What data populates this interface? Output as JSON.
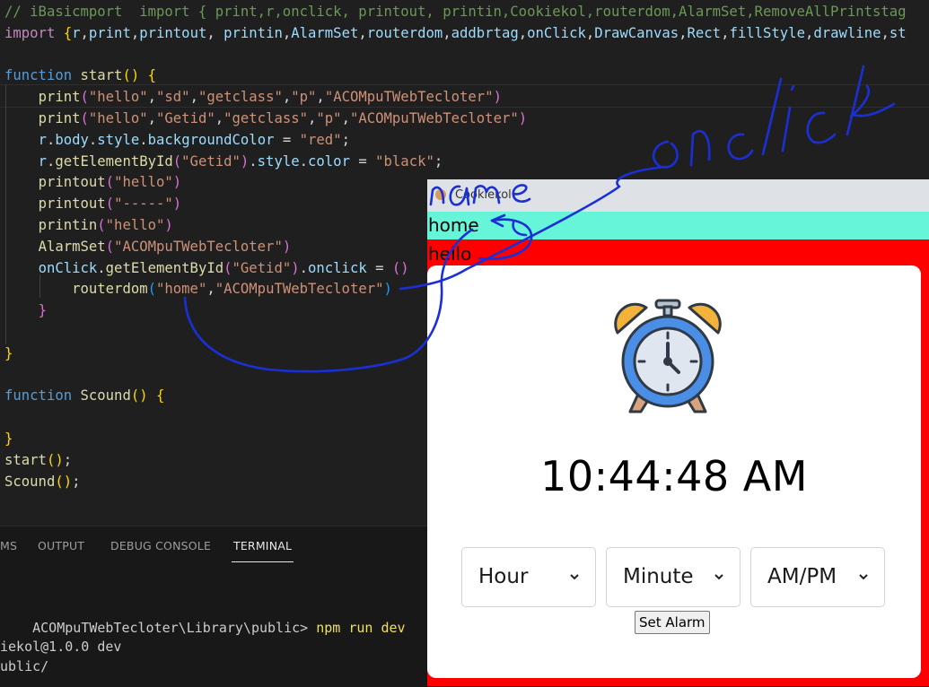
{
  "editor": {
    "lines": [
      [
        [
          "tk-cmt",
          "// iBasicmport  import { print,r,onclick, printout, printin,Cookiekol,routerdom,AlarmSet,RemoveAllPrintstag"
        ]
      ],
      [
        [
          "tk-kw2",
          "import "
        ],
        [
          "tk-b1",
          "{"
        ],
        [
          "tk-var",
          "r"
        ],
        [
          "tk-pl",
          ","
        ],
        [
          "tk-var",
          "print"
        ],
        [
          "tk-pl",
          ","
        ],
        [
          "tk-var",
          "printout"
        ],
        [
          "tk-pl",
          ", "
        ],
        [
          "tk-var",
          "printin"
        ],
        [
          "tk-pl",
          ","
        ],
        [
          "tk-var",
          "AlarmSet"
        ],
        [
          "tk-pl",
          ","
        ],
        [
          "tk-var",
          "routerdom"
        ],
        [
          "tk-pl",
          ","
        ],
        [
          "tk-var",
          "addbrtag"
        ],
        [
          "tk-pl",
          ","
        ],
        [
          "tk-var",
          "onClick"
        ],
        [
          "tk-pl",
          ","
        ],
        [
          "tk-var",
          "DrawCanvas"
        ],
        [
          "tk-pl",
          ","
        ],
        [
          "tk-var",
          "Rect"
        ],
        [
          "tk-pl",
          ","
        ],
        [
          "tk-var",
          "fillStyle"
        ],
        [
          "tk-pl",
          ","
        ],
        [
          "tk-var",
          "drawline"
        ],
        [
          "tk-pl",
          ","
        ],
        [
          "tk-var",
          "st"
        ]
      ],
      [],
      [
        [
          "tk-kw",
          "function "
        ],
        [
          "tk-fn",
          "start"
        ],
        [
          "tk-b1",
          "() {"
        ]
      ],
      [
        [
          "tk-pl",
          "    "
        ],
        [
          "tk-fn",
          "print"
        ],
        [
          "tk-b2",
          "("
        ],
        [
          "tk-str",
          "\"hello\""
        ],
        [
          "tk-pl",
          ","
        ],
        [
          "tk-str",
          "\"sd\""
        ],
        [
          "tk-pl",
          ","
        ],
        [
          "tk-str",
          "\"getclass\""
        ],
        [
          "tk-pl",
          ","
        ],
        [
          "tk-str",
          "\"p\""
        ],
        [
          "tk-pl",
          ","
        ],
        [
          "tk-str",
          "\"ACOMpuTWebTecloter\""
        ],
        [
          "tk-b2",
          ")"
        ]
      ],
      [
        [
          "tk-pl",
          "    "
        ],
        [
          "tk-fn",
          "print"
        ],
        [
          "tk-b2",
          "("
        ],
        [
          "tk-str",
          "\"hello\""
        ],
        [
          "tk-pl",
          ","
        ],
        [
          "tk-str",
          "\"Getid\""
        ],
        [
          "tk-pl",
          ","
        ],
        [
          "tk-str",
          "\"getclass\""
        ],
        [
          "tk-pl",
          ","
        ],
        [
          "tk-str",
          "\"p\""
        ],
        [
          "tk-pl",
          ","
        ],
        [
          "tk-str",
          "\"ACOMpuTWebTecloter\""
        ],
        [
          "tk-b2",
          ")"
        ]
      ],
      [
        [
          "tk-pl",
          "    "
        ],
        [
          "tk-var",
          "r"
        ],
        [
          "tk-pl",
          "."
        ],
        [
          "tk-var",
          "body"
        ],
        [
          "tk-pl",
          "."
        ],
        [
          "tk-var",
          "style"
        ],
        [
          "tk-pl",
          "."
        ],
        [
          "tk-var",
          "backgroundColor"
        ],
        [
          "tk-pl",
          " = "
        ],
        [
          "tk-str",
          "\"red\""
        ],
        [
          "tk-pl",
          ";"
        ]
      ],
      [
        [
          "tk-pl",
          "    "
        ],
        [
          "tk-var",
          "r"
        ],
        [
          "tk-pl",
          "."
        ],
        [
          "tk-fn",
          "getElementById"
        ],
        [
          "tk-b2",
          "("
        ],
        [
          "tk-str",
          "\"Getid\""
        ],
        [
          "tk-b2",
          ")"
        ],
        [
          "tk-pl",
          "."
        ],
        [
          "tk-var",
          "style"
        ],
        [
          "tk-pl",
          "."
        ],
        [
          "tk-var",
          "color"
        ],
        [
          "tk-pl",
          " = "
        ],
        [
          "tk-str",
          "\"black\""
        ],
        [
          "tk-pl",
          ";"
        ]
      ],
      [
        [
          "tk-pl",
          "    "
        ],
        [
          "tk-fn",
          "printout"
        ],
        [
          "tk-b2",
          "("
        ],
        [
          "tk-str",
          "\"hello\""
        ],
        [
          "tk-b2",
          ")"
        ]
      ],
      [
        [
          "tk-pl",
          "    "
        ],
        [
          "tk-fn",
          "printout"
        ],
        [
          "tk-b2",
          "("
        ],
        [
          "tk-str",
          "\"-----\""
        ],
        [
          "tk-b2",
          ")"
        ]
      ],
      [
        [
          "tk-pl",
          "    "
        ],
        [
          "tk-fn",
          "printin"
        ],
        [
          "tk-b2",
          "("
        ],
        [
          "tk-str",
          "\"hello\""
        ],
        [
          "tk-b2",
          ")"
        ]
      ],
      [
        [
          "tk-pl",
          "    "
        ],
        [
          "tk-fn",
          "AlarmSet"
        ],
        [
          "tk-b2",
          "("
        ],
        [
          "tk-str",
          "\"ACOMpuTWebTecloter\""
        ],
        [
          "tk-b2",
          ")"
        ]
      ],
      [
        [
          "tk-pl",
          "    "
        ],
        [
          "tk-var",
          "onClick"
        ],
        [
          "tk-pl",
          "."
        ],
        [
          "tk-fn",
          "getElementById"
        ],
        [
          "tk-b2",
          "("
        ],
        [
          "tk-str",
          "\"Getid\""
        ],
        [
          "tk-b2",
          ")"
        ],
        [
          "tk-pl",
          "."
        ],
        [
          "tk-var",
          "onclick"
        ],
        [
          "tk-pl",
          " = "
        ],
        [
          "tk-b2",
          "()"
        ]
      ],
      [
        [
          "tk-pl",
          "        "
        ],
        [
          "tk-fn",
          "routerdom"
        ],
        [
          "tk-b3",
          "("
        ],
        [
          "tk-str",
          "\"home\""
        ],
        [
          "tk-pl",
          ","
        ],
        [
          "tk-str",
          "\"ACOMpuTWebTecloter\""
        ],
        [
          "tk-b3",
          ")"
        ]
      ],
      [
        [
          "tk-pl",
          "    "
        ],
        [
          "tk-b2",
          "}"
        ]
      ],
      [],
      [
        [
          "tk-b1",
          "}"
        ]
      ],
      [],
      [
        [
          "tk-kw",
          "function "
        ],
        [
          "tk-fn",
          "Scound"
        ],
        [
          "tk-b1",
          "() {"
        ]
      ],
      [],
      [
        [
          "tk-b1",
          "}"
        ]
      ],
      [
        [
          "tk-fn",
          "start"
        ],
        [
          "tk-b1",
          "()"
        ],
        [
          "tk-pl",
          ";"
        ]
      ],
      [
        [
          "tk-fn",
          "Scound"
        ],
        [
          "tk-b1",
          "()"
        ],
        [
          "tk-pl",
          ";"
        ]
      ]
    ]
  },
  "panel": {
    "tabs": [
      "MS",
      "OUTPUT",
      "DEBUG CONSOLE",
      "TERMINAL"
    ],
    "active_tab": "TERMINAL",
    "terminal_path": "ACOMpuTWebTecloter\\Library\\public> ",
    "terminal_command": "npm run dev",
    "terminal_output_1": "iekol@1.0.0 dev",
    "terminal_output_2": "ublic/"
  },
  "browser": {
    "tab_title": "Cookiekol",
    "nav_home": "home",
    "nav_hello": "hello",
    "time": "10:44:48 AM",
    "hour_select": "Hour",
    "minute_select": "Minute",
    "ampm_select": "AM/PM",
    "set_alarm_label": "Set Alarm",
    "background_color": "#ff0000",
    "nav_color": "#66f5d9"
  },
  "annotations": {
    "onclick_word": "onclick",
    "name_word": "name"
  },
  "colors": {
    "scribble": "#1a2fd6"
  }
}
